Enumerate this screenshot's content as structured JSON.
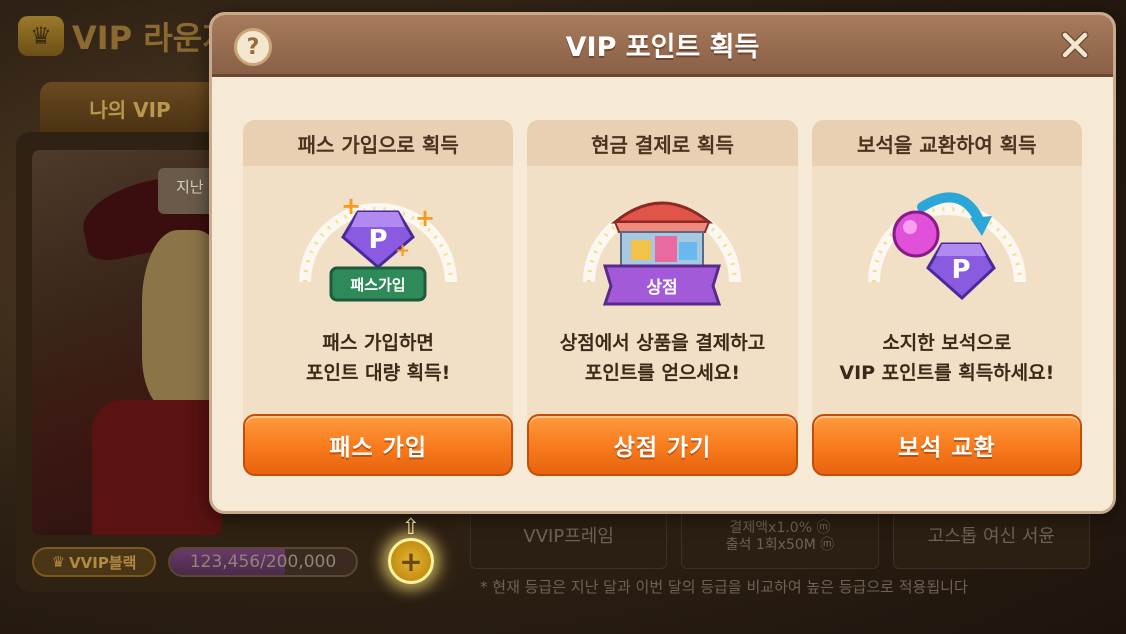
{
  "background": {
    "lounge_title": "VIP 라운지",
    "tab_my_vip": "나의 VIP",
    "tooltip_partial": "지난",
    "grade_badge": "VVIP블랙",
    "grade_progress_text": "123,456/200,000",
    "grade_progress_fraction": 0.617,
    "benefits": [
      {
        "line1": "VVIP프레임",
        "line2": ""
      },
      {
        "line1": "결제액x1.0% ⓜ",
        "line2": "출석 1회x50M ⓜ"
      },
      {
        "line1": "고스톱 여신 서윤",
        "line2": ""
      }
    ],
    "footer_note": "* 현재 등급은 지난 달과 이번 달의 등급을 비교하여 높은 등급으로 적용됩니다"
  },
  "modal": {
    "title": "VIP 포인트 획득",
    "help_icon": "?",
    "cards": [
      {
        "header": "패스 가입으로 획득",
        "art_badge": "패스가입",
        "art_icon": "P",
        "desc_line1": "패스 가입하면",
        "desc_line2": "포인트 대량 획득!",
        "button": "패스 가입"
      },
      {
        "header": "현금 결제로 획득",
        "art_badge": "상점",
        "desc_line1": "상점에서 상품을 결제하고",
        "desc_line2": "포인트를 얻으세요!",
        "button": "상점 가기"
      },
      {
        "header": "보석을 교환하여 획득",
        "art_icon": "P",
        "desc_line1": "소지한 보석으로",
        "desc_line2": "VIP 포인트를 획득하세요!",
        "button": "보석 교환"
      }
    ]
  },
  "colors": {
    "button_orange": "#f77a1c",
    "header_brown": "#9a6e52",
    "panel_cream": "#f6ead6",
    "gem_purple": "#8a5ae0",
    "badge_green": "#2f8a5a"
  }
}
